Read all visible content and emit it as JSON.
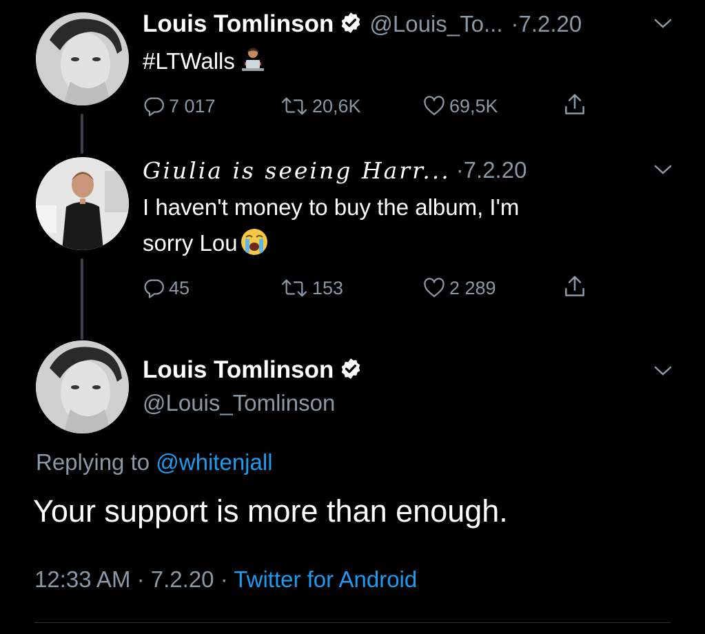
{
  "tweet1": {
    "name": "Louis Tomlinson",
    "handle": "@Louis_To...",
    "date": "·7.2.20",
    "text": "#LTWalls",
    "emoji": "computer-user-emoji",
    "reply_count": "7 017",
    "retweet_count": "20,6K",
    "like_count": "69,5K"
  },
  "tweet2": {
    "name": "Giulia is seeing Harr...",
    "date": "·7.2.20",
    "text_line1": "I haven't money to buy the album, I'm",
    "text_line2": "sorry Lou",
    "emoji": "loudly-crying-face-emoji",
    "reply_count": "45",
    "retweet_count": "153",
    "like_count": "2 289"
  },
  "main_tweet": {
    "name": "Louis Tomlinson",
    "handle": "@Louis_Tomlinson",
    "replying_prefix": "Replying to",
    "replying_to": "@whitenjall",
    "text": "Your support is more than enough.",
    "time": "12:33 AM",
    "separator": "·",
    "date": "7.2.20",
    "source": "Twitter for Android"
  },
  "icons": {
    "reply": "reply-icon",
    "retweet": "retweet-icon",
    "like": "heart-icon",
    "share": "share-icon",
    "verified": "verified-badge-icon",
    "more": "chevron-down-icon"
  },
  "colors": {
    "background": "#000000",
    "text": "#ffffff",
    "muted": "#8b98a5",
    "link": "#1d9bf0",
    "thread_line": "#3d4147"
  }
}
